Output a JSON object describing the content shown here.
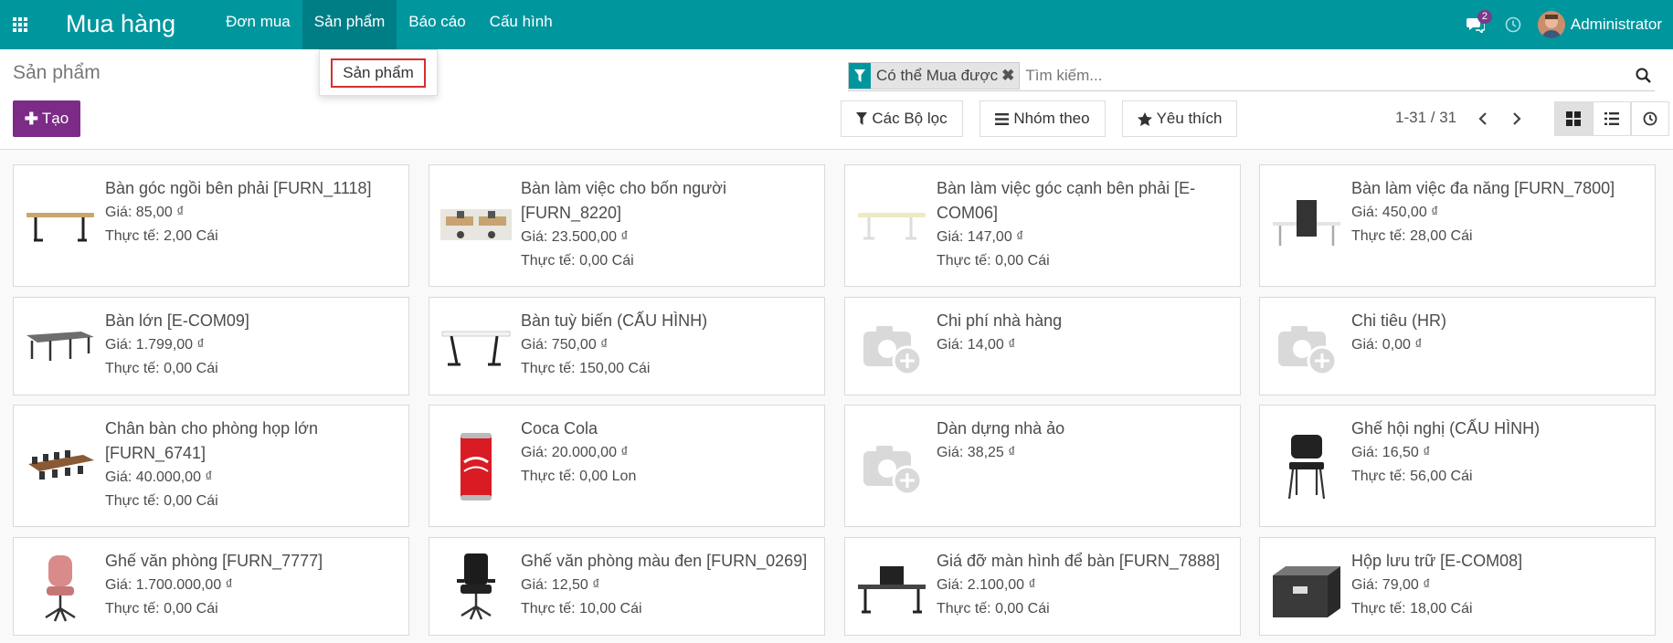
{
  "navbar": {
    "app_title": "Mua hàng",
    "menu": [
      "Đơn mua",
      "Sản phẩm",
      "Báo cáo",
      "Cấu hình"
    ],
    "chat_count": "2",
    "user_name": "Administrator"
  },
  "dropdown": {
    "item": "Sản phẩm"
  },
  "control": {
    "breadcrumb": "Sản phẩm",
    "create_label": "Tạo",
    "facet_label": "Có thể Mua được",
    "search_placeholder": "Tìm kiếm...",
    "filters_label": "Các Bộ lọc",
    "groupby_label": "Nhóm theo",
    "favorites_label": "Yêu thích",
    "pager": "1-31 / 31"
  },
  "products": [
    {
      "name": "Bàn góc ngồi bên phải [FURN_1118]",
      "price": "Giá: 85,00 ₫",
      "qty": "Thực tế: 2,00 Cái",
      "image": "desk-oak"
    },
    {
      "name": "Bàn làm việc cho bốn người [FURN_8220]",
      "price": "Giá: 23.500,00 ₫",
      "qty": "Thực tế: 0,00 Cái",
      "image": "desk-four"
    },
    {
      "name": "Bàn làm việc góc cạnh bên phải [E-COM06]",
      "price": "Giá: 147,00 ₫",
      "qty": "Thực tế: 0,00 Cái",
      "image": "desk-cream"
    },
    {
      "name": "Bàn làm việc đa năng [FURN_7800]",
      "price": "Giá: 450,00 ₫",
      "qty": "Thực tế: 28,00 Cái",
      "image": "desk-panel"
    },
    {
      "name": "Bàn lớn [E-COM09]",
      "price": "Giá: 1.799,00 ₫",
      "qty": "Thực tế: 0,00 Cái",
      "image": "desk-large"
    },
    {
      "name": "Bàn tuỳ biến (CẤU HÌNH)",
      "price": "Giá: 750,00 ₫",
      "qty": "Thực tế: 150,00 Cái",
      "image": "desk-white"
    },
    {
      "name": "Chi phí nhà hàng",
      "price": "Giá: 14,00 ₫",
      "qty": "",
      "image": "placeholder"
    },
    {
      "name": "Chi tiêu (HR)",
      "price": "Giá: 0,00 ₫",
      "qty": "",
      "image": "placeholder"
    },
    {
      "name": "Chân bàn cho phòng họp lớn [FURN_6741]",
      "price": "Giá: 40.000,00 ₫",
      "qty": "Thực tế: 0,00 Cái",
      "image": "conference"
    },
    {
      "name": "Coca Cola",
      "price": "Giá: 20.000,00 ₫",
      "qty": "Thực tế: 0,00 Lon",
      "image": "can"
    },
    {
      "name": "Dàn dựng nhà ảo",
      "price": "Giá: 38,25 ₫",
      "qty": "",
      "image": "placeholder"
    },
    {
      "name": "Ghế hội nghị (CẤU HÌNH)",
      "price": "Giá: 16,50 ₫",
      "qty": "Thực tế: 56,00 Cái",
      "image": "chair-black"
    },
    {
      "name": "Ghế văn phòng [FURN_7777]",
      "price": "Giá: 1.700.000,00 ₫",
      "qty": "Thực tế: 0,00 Cái",
      "image": "chair-pink"
    },
    {
      "name": "Ghế văn phòng màu đen [FURN_0269]",
      "price": "Giá: 12,50 ₫",
      "qty": "Thực tế: 10,00 Cái",
      "image": "chair-office"
    },
    {
      "name": "Giá đỡ màn hình để bàn [FURN_7888]",
      "price": "Giá: 2.100,00 ₫",
      "qty": "Thực tế: 0,00 Cái",
      "image": "monitor-stand"
    },
    {
      "name": "Hộp lưu trữ [E-COM08]",
      "price": "Giá: 79,00 ₫",
      "qty": "Thực tế: 18,00 Cái",
      "image": "box"
    }
  ]
}
